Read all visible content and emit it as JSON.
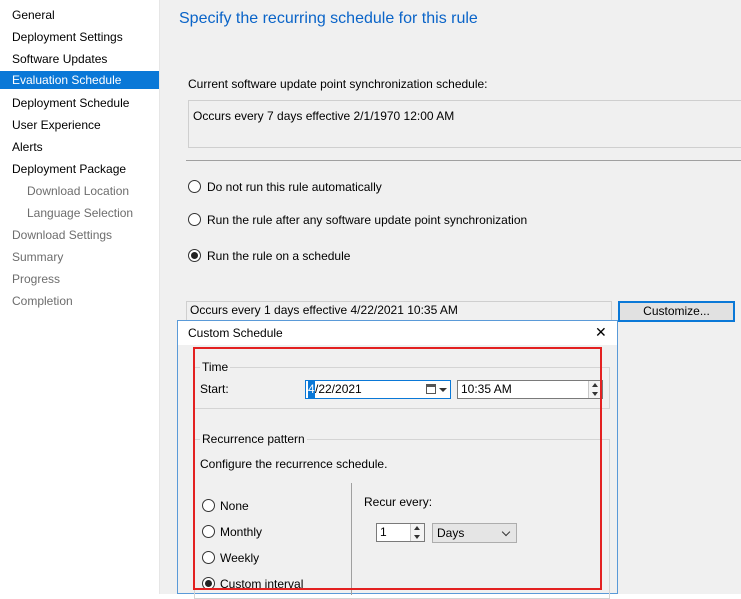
{
  "sidebar": {
    "items": [
      {
        "label": "General",
        "state": "normal"
      },
      {
        "label": "Deployment Settings",
        "state": "normal"
      },
      {
        "label": "Software Updates",
        "state": "normal"
      },
      {
        "label": "Evaluation Schedule",
        "state": "selected"
      },
      {
        "label": "Deployment Schedule",
        "state": "normal"
      },
      {
        "label": "User Experience",
        "state": "normal"
      },
      {
        "label": "Alerts",
        "state": "normal"
      },
      {
        "label": "Deployment Package",
        "state": "normal"
      },
      {
        "label": "Download Location",
        "state": "disabled"
      },
      {
        "label": "Language Selection",
        "state": "disabled"
      },
      {
        "label": "Download Settings",
        "state": "disabled"
      },
      {
        "label": "Summary",
        "state": "disabled"
      },
      {
        "label": "Progress",
        "state": "disabled"
      },
      {
        "label": "Completion",
        "state": "disabled"
      }
    ]
  },
  "main": {
    "title": "Specify the recurring schedule for this rule",
    "sync_label": "Current software update point synchronization schedule:",
    "sync_schedule": "Occurs every 7 days effective 2/1/1970 12:00 AM",
    "options": [
      {
        "label": "Do not run this rule automatically",
        "checked": false
      },
      {
        "label": "Run the rule after any software update point synchronization",
        "checked": false
      },
      {
        "label": "Run the rule on a schedule",
        "checked": true
      }
    ],
    "schedule_summary": "Occurs every 1 days effective 4/22/2021 10:35 AM",
    "customize_label": "Customize..."
  },
  "dialog": {
    "title": "Custom Schedule",
    "close_glyph": "✕",
    "time_group": "Time",
    "start_label": "Start:",
    "start_date_first": "4",
    "start_date_rest": "/22/2021",
    "start_time": "10:35 AM",
    "recurrence_group": "Recurrence pattern",
    "recurrence_hint": "Configure the recurrence schedule.",
    "patterns": [
      {
        "label": "None",
        "checked": false
      },
      {
        "label": "Monthly",
        "checked": false
      },
      {
        "label": "Weekly",
        "checked": false
      },
      {
        "label": "Custom interval",
        "checked": true
      }
    ],
    "recur_every_label": "Recur every:",
    "recur_value": "1",
    "recur_unit": "Days"
  },
  "colors": {
    "accent": "#0a78d7",
    "title_blue": "#0a64c8",
    "highlight_red": "#e32020"
  }
}
